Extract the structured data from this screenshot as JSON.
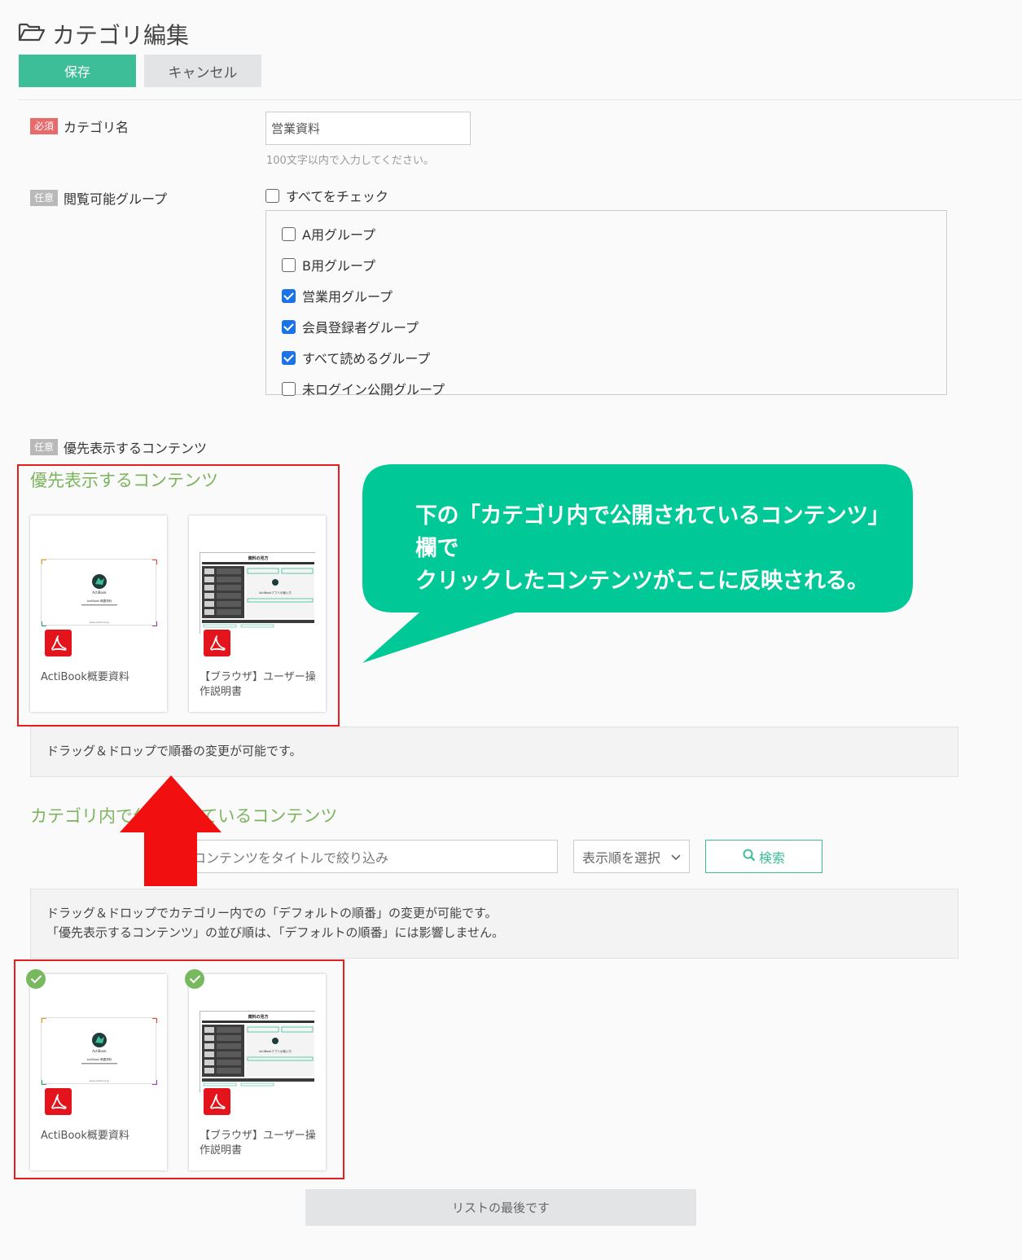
{
  "header": {
    "title": "カテゴリ編集",
    "save_label": "保存",
    "cancel_label": "キャンセル"
  },
  "category_name": {
    "badge": "必須",
    "label": "カテゴリ名",
    "value": "営業資料",
    "hint": "100文字以内で入力してください。"
  },
  "groups": {
    "badge": "任意",
    "label": "閲覧可能グループ",
    "check_all_label": "すべてをチェック",
    "items": [
      {
        "label": "A用グループ",
        "checked": false
      },
      {
        "label": "B用グループ",
        "checked": false
      },
      {
        "label": "営業用グループ",
        "checked": true
      },
      {
        "label": "会員登録者グループ",
        "checked": true
      },
      {
        "label": "すべて読めるグループ",
        "checked": true
      },
      {
        "label": "未ログイン公開グループ",
        "checked": false
      }
    ]
  },
  "priority": {
    "badge": "任意",
    "label": "優先表示するコンテンツ",
    "heading": "優先表示するコンテンツ",
    "cards": [
      {
        "title": "ActiBook概要資料"
      },
      {
        "title": "【ブラウザ】ユーザー操作説明書"
      }
    ],
    "notice": "ドラッグ＆ドロップで順番の変更が可能です。"
  },
  "callout": {
    "line1": "下の「カテゴリ内で公開されているコンテンツ」欄で",
    "line2": "クリックしたコンテンツがここに反映される。"
  },
  "published": {
    "heading": "カテゴリ内で公開されているコンテンツ",
    "filter_placeholder": "コンテンツをタイトルで絞り込み",
    "sort_placeholder": "表示順を選択",
    "search_label": "検索",
    "notice_line1": "ドラッグ＆ドロップでカテゴリー内での「デフォルトの順番」の変更が可能です。",
    "notice_line2": "「優先表示するコンテンツ」の並び順は、「デフォルトの順番」には影響しません。",
    "cards": [
      {
        "title": "ActiBook概要資料",
        "selected": true
      },
      {
        "title": "【ブラウザ】ユーザー操作説明書",
        "selected": true
      }
    ],
    "end_label": "リストの最後です"
  },
  "thumbnail_text": {
    "guide_title": "資料の見方",
    "actibook_brand": "ActiBook",
    "actibook_line": "ActiBook 概要資料",
    "actibook_footer": "www.actibook.jp",
    "guide_center": "ActiBookアプリの使い方"
  },
  "colors": {
    "accent": "#3dbd98",
    "heading_green": "#7cb45e",
    "callout": "#00c896",
    "highlight_red": "#e81e1e",
    "pdf_red": "#e3141b"
  }
}
